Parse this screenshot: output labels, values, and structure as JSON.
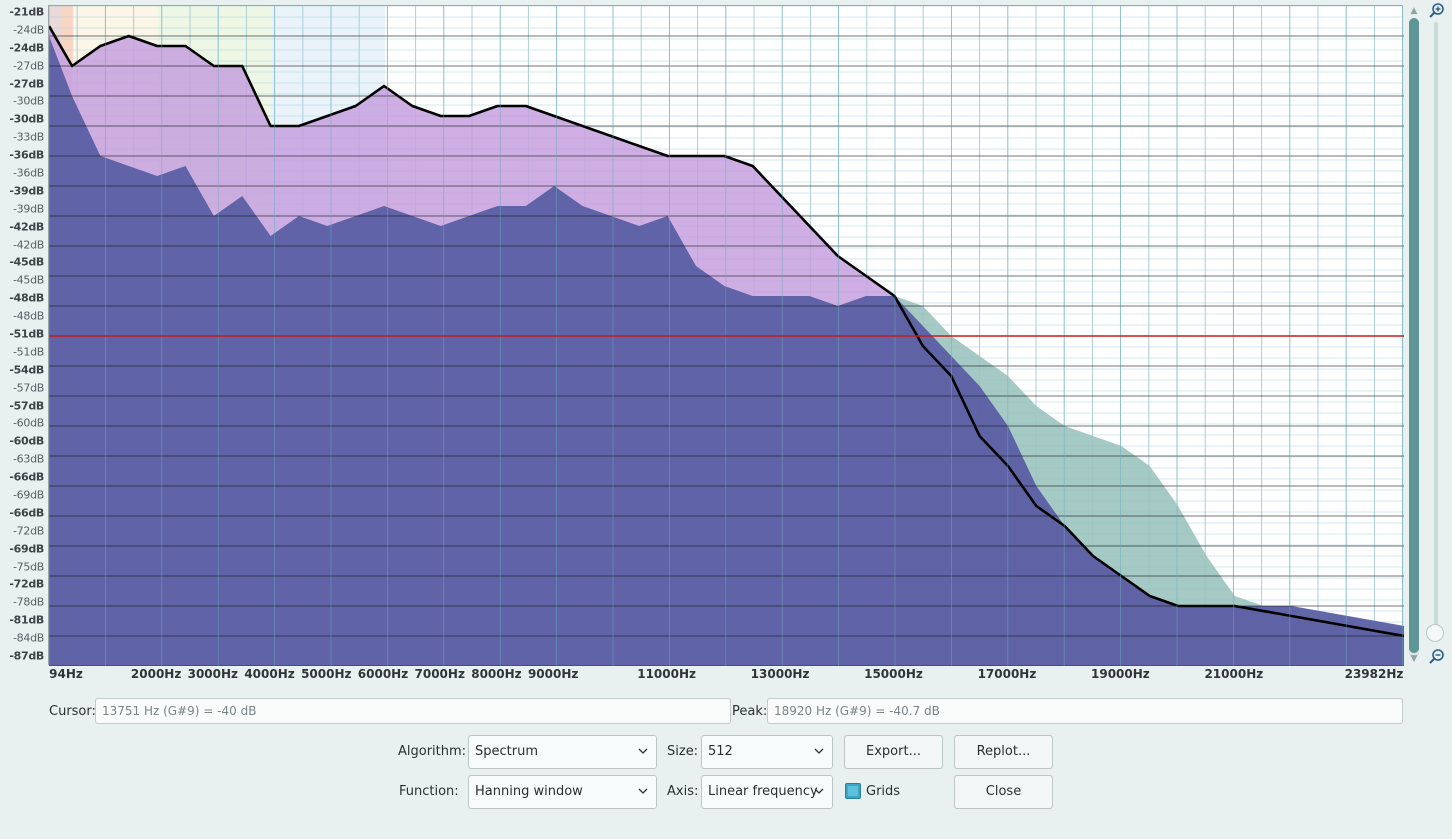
{
  "window": {
    "background": "#e9f0f0"
  },
  "plot": {
    "y_axis_labels": [
      "-21dB",
      "-24dB",
      "-24dB",
      "-27dB",
      "-27dB",
      "-30dB",
      "-30dB",
      "-33dB",
      "-36dB",
      "-36dB",
      "-39dB",
      "-39dB",
      "-42dB",
      "-42dB",
      "-45dB",
      "-45dB",
      "-48dB",
      "-48dB",
      "-51dB",
      "-51dB",
      "-54dB",
      "-57dB",
      "-57dB",
      "-60dB",
      "-60dB",
      "-63dB",
      "-66dB",
      "-69dB",
      "-66dB",
      "-72dB",
      "-69dB",
      "-75dB",
      "-72dB",
      "-78dB",
      "-81dB",
      "-84dB",
      "-87dB"
    ],
    "x_axis_labels": [
      "94Hz",
      "2000Hz",
      "3000Hz",
      "4000Hz",
      "5000Hz",
      "6000Hz",
      "7000Hz",
      "8000Hz",
      "9000Hz",
      "11000Hz",
      "13000Hz",
      "15000Hz",
      "17000Hz",
      "19000Hz",
      "21000Hz",
      "23982Hz"
    ],
    "colors": {
      "spectrum_fill": "#5a5fa3",
      "second_fill": "#c6a0de",
      "third_fill": "#9bc3bf",
      "grid_major": "#444444",
      "grid_minor": "#a9cfd7",
      "cursor_line": "#c41c1c"
    },
    "chart_data": {
      "type": "area",
      "xlabel": "",
      "ylabel": "",
      "xlim": [
        94,
        23982
      ],
      "ylim": [
        -87,
        -21
      ],
      "grid": true,
      "series": [
        {
          "x": [
            94,
            500,
            1000,
            1500,
            2000,
            2500,
            3000,
            3500,
            4000,
            4500,
            5000,
            5500,
            6000,
            6500,
            7000,
            7500,
            8000,
            8500,
            9000,
            9500,
            10000,
            10500,
            11000,
            11500,
            12000,
            12500,
            13000,
            13500,
            14000,
            14500,
            15000,
            15500,
            16000,
            16500,
            17000,
            17500,
            18000,
            18500,
            19000,
            19500,
            20000,
            21000,
            22000,
            23982
          ],
          "values": [
            -24,
            -30,
            -36,
            -37,
            -38,
            -37,
            -42,
            -40,
            -44,
            -42,
            -43,
            -42,
            -41,
            -42,
            -43,
            -42,
            -41,
            -41,
            -39,
            -41,
            -42,
            -43,
            -42,
            -47,
            -49,
            -50,
            -50,
            -50,
            -51,
            -50,
            -50,
            -53,
            -56,
            -59,
            -63,
            -69,
            -73,
            -76,
            -78,
            -80,
            -81,
            -81,
            -81,
            -83
          ]
        },
        {
          "x": [
            94,
            500,
            1000,
            1500,
            2000,
            2500,
            3000,
            3500,
            4000,
            4500,
            5000,
            5500,
            6000,
            6500,
            7000,
            7500,
            8000,
            8500,
            9000,
            9500,
            10000,
            10500,
            11000,
            11500,
            12000,
            12500,
            13000,
            13500,
            14000,
            14500,
            15000,
            15500,
            16000,
            16500,
            17000,
            17500,
            18000,
            18500,
            19000,
            19500,
            20000,
            21000,
            22000,
            23982
          ],
          "values": [
            -23,
            -27,
            -25,
            -24,
            -25,
            -25,
            -27,
            -27,
            -33,
            -33,
            -32,
            -31,
            -29,
            -31,
            -32,
            -32,
            -31,
            -31,
            -32,
            -33,
            -34,
            -35,
            -36,
            -36,
            -36,
            -37,
            -40,
            -43,
            -46,
            -48,
            -50,
            -55,
            -58,
            -64,
            -67,
            -71,
            -73,
            -76,
            -78,
            -80,
            -81,
            -81,
            -82,
            -84
          ]
        },
        {
          "x": [
            15000,
            15500,
            16000,
            16500,
            17000,
            17500,
            18000,
            18500,
            19000,
            19500,
            20000,
            20500,
            21000,
            22000,
            23982
          ],
          "values": [
            -50,
            -51,
            -54,
            -56,
            -58,
            -61,
            -63,
            -64,
            -65,
            -67,
            -71,
            -76,
            -80,
            -82,
            -84
          ]
        }
      ],
      "cursor_line_db": -54
    }
  },
  "info": {
    "cursor_label": "Cursor:",
    "cursor_value": "13751 Hz (G#9) = -40 dB",
    "peak_label": "Peak:",
    "peak_value": "18920 Hz (G#9) = -40.7 dB"
  },
  "controls": {
    "algorithm_label": "Algorithm:",
    "algorithm_value": "Spectrum",
    "size_label": "Size:",
    "size_value": "512",
    "export_button": "Export...",
    "replot_button": "Replot...",
    "function_label": "Function:",
    "function_value": "Hanning window",
    "axis_label": "Axis:",
    "axis_value": "Linear frequency",
    "grids_label": "Grids",
    "grids_checked": true,
    "close_button": "Close"
  }
}
